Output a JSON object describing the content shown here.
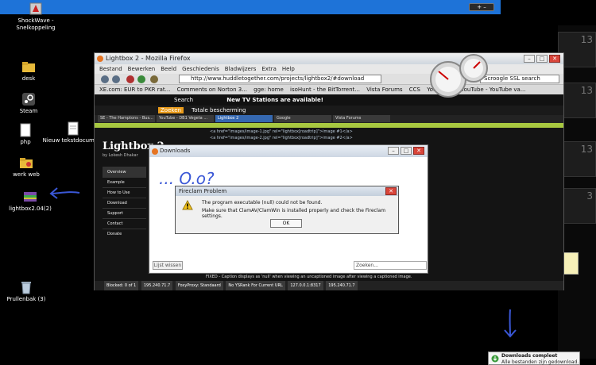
{
  "desktop": {
    "icons": [
      {
        "label": "ShockWave -\nSnelkoppeling",
        "icon": "shockwave-icon"
      },
      {
        "label": "desk",
        "icon": "folder-icon"
      },
      {
        "label": "Steam",
        "icon": "steam-icon"
      },
      {
        "label": "php",
        "icon": "document-icon"
      },
      {
        "label": "Nieuw tekstdocument",
        "icon": "document-icon"
      },
      {
        "label": "werk web",
        "icon": "folder-icon"
      },
      {
        "label": "lightbox2.04(2)",
        "icon": "archive-icon"
      },
      {
        "label": "Prullenbak (3)",
        "icon": "recycle-bin-icon"
      }
    ]
  },
  "firefox": {
    "title": "Lightbox 2 - Mozilla Firefox",
    "menu": [
      "Bestand",
      "Bewerken",
      "Beeld",
      "Geschiedenis",
      "Bladwijzers",
      "Extra",
      "Help"
    ],
    "url": "http://www.huddletogether.com/projects/lightbox2/#download",
    "search_placeholder": "Scroogle SSL search",
    "bookmarks": [
      "XE.com: EUR to PKR rat...",
      "Comments on Norton 3...",
      "gge: home",
      "isoHunt - the BitTorrent...",
      "Vista Forums",
      "CCS",
      "You",
      "web",
      "YouTube - YouTube va..."
    ],
    "toolbar2": {
      "search": "Search",
      "news": "New TV Stations are available!"
    },
    "toolbar3": {
      "left": "Zoeken",
      "protection": "Totale bescherming"
    },
    "tabs": [
      "SE - The Hamptons - Bus...",
      "YouTube - DB1 Vegeta ...",
      "Lightbox 2",
      "Google",
      "Vista Forums"
    ],
    "page": {
      "title": "Lightbox 2",
      "subtitle": "by Lokesh Dhakar",
      "nav": [
        "Overview",
        "Example",
        "How to Use",
        "Download",
        "Support",
        "Contact",
        "Donate"
      ],
      "code": [
        "<a href=\"images/image-1.jpg\" rel=\"lightbox[roadtrip]\">image #1</a>",
        "<a href=\"images/image-2.jpg\" rel=\"lightbox[roadtrip]\">image #2</a>"
      ],
      "caption": "FIXED - Caption displays as 'null' when viewing an uncaptioned image after viewing a captioned image."
    },
    "status": [
      "Blocked: 0 of 1",
      "195.240.71.7",
      "FoxyProxy: Standaard",
      "No YSRank For Current URL",
      "127.0.0.1:8317",
      "195.240.71.7"
    ]
  },
  "downloads": {
    "title": "Downloads",
    "clear_button": "Lijst wissen",
    "search_placeholder": "Zoeken..."
  },
  "handwriting": "... O.o?",
  "error_dialog": {
    "title": "Fireclam Problem",
    "line1": "The program executable (null) could not be found.",
    "line2": "Make sure that ClamAV/ClamWin is installed properly and check the Fireclam settings.",
    "ok": "OK"
  },
  "toast": {
    "title": "Downloads compleet",
    "subtitle": "Alle bestanden zijn gedownload."
  },
  "colors": {
    "taskbar": "#1e73d8",
    "error_close": "#d9453a",
    "page_accent": "#a8c840",
    "annotation": "#3a57d6"
  }
}
